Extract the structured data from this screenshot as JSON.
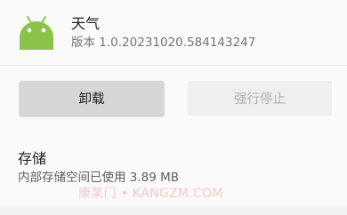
{
  "app": {
    "name": "天气",
    "version": "版本 1.0.20231020.584143247",
    "icon": "android-robot-icon",
    "icon_color": "#8bc34a"
  },
  "actions": {
    "uninstall_label": "卸载",
    "force_stop_label": "强行停止",
    "force_stop_enabled": false
  },
  "storage": {
    "title": "存储",
    "detail": "内部存储空间已使用 3.89 MB"
  },
  "watermark": {
    "text": "康某门 • KANGZM.COM"
  }
}
